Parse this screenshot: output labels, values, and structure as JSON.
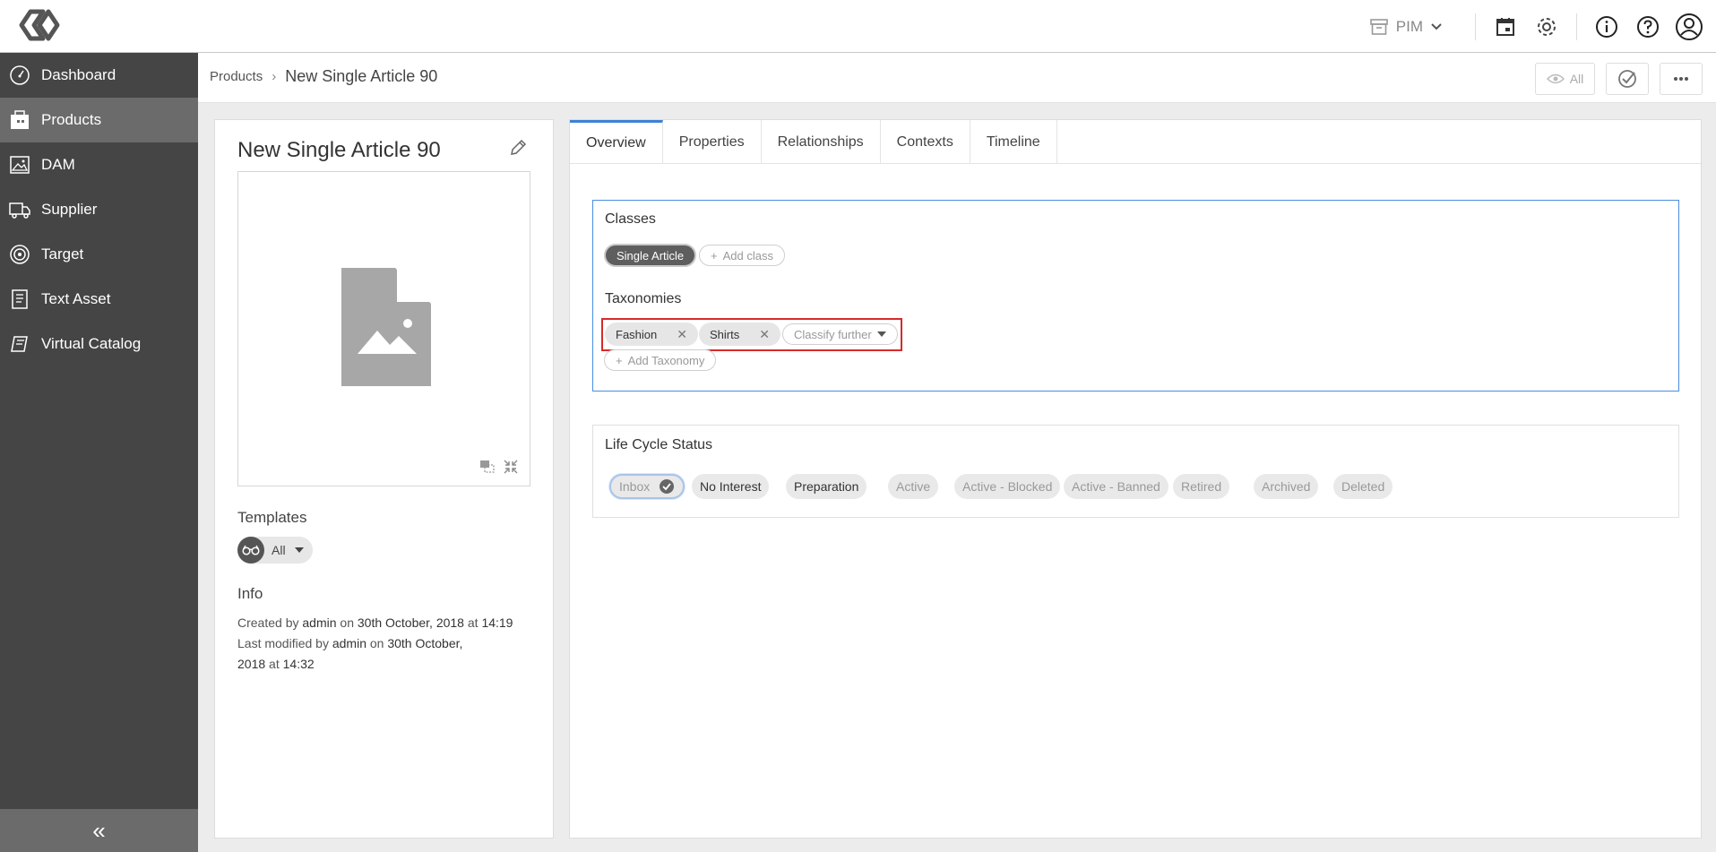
{
  "topbar": {
    "app_switcher": "PIM",
    "icons": [
      "calendar-icon",
      "gear-icon",
      "info-icon",
      "help-icon",
      "user-icon"
    ]
  },
  "sidebar": {
    "items": [
      {
        "label": "Dashboard",
        "icon": "gauge-icon"
      },
      {
        "label": "Products",
        "icon": "products-icon",
        "active": true
      },
      {
        "label": "DAM",
        "icon": "image-icon"
      },
      {
        "label": "Supplier",
        "icon": "truck-icon"
      },
      {
        "label": "Target",
        "icon": "target-icon"
      },
      {
        "label": "Text Asset",
        "icon": "document-icon"
      },
      {
        "label": "Virtual Catalog",
        "icon": "catalog-icon"
      }
    ],
    "collapse_label": "«"
  },
  "breadcrumb": {
    "parent": "Products",
    "separator": "›",
    "current": "New Single Article 90",
    "view_filter": "All"
  },
  "product": {
    "title": "New Single Article 90",
    "templates_label": "Templates",
    "template_value": "All",
    "info_label": "Info",
    "created_prefix": "Created by",
    "created_user": "admin",
    "created_on_word": "on",
    "created_date": "30th October, 2018",
    "created_at_word": "at",
    "created_time": "14:19",
    "modified_prefix": "Last modified by",
    "modified_user": "admin",
    "modified_on_word": "on",
    "modified_date_part1": "30th October,",
    "modified_date_part2": "2018",
    "modified_at_word": "at",
    "modified_time": "14:32"
  },
  "tabs": [
    "Overview",
    "Properties",
    "Relationships",
    "Contexts",
    "Timeline"
  ],
  "overview": {
    "classes_title": "Classes",
    "class_chip": "Single Article",
    "add_class": "Add class",
    "taxonomies_title": "Taxonomies",
    "taxonomy_chips": [
      "Fashion",
      "Shirts"
    ],
    "classify_further": "Classify further",
    "add_taxonomy": "Add Taxonomy",
    "lifecycle_title": "Life Cycle Status",
    "lifecycle": [
      "Inbox",
      "No Interest",
      "Preparation",
      "Active",
      "Active - Blocked",
      "Active - Banned",
      "Retired",
      "Archived",
      "Deleted"
    ]
  },
  "colors": {
    "sidebar_bg": "#454545",
    "sidebar_active": "#6b6b6b",
    "accent": "#3b82d8",
    "highlight_box": "#d62a2a"
  }
}
